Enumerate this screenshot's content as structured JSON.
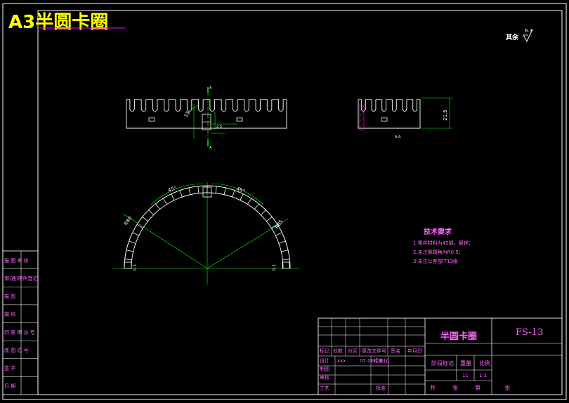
{
  "sheet_title": "A3半圆卡圈",
  "roughness": {
    "label": "其余",
    "value": "6.3"
  },
  "tech": {
    "heading": "技术要求",
    "items": [
      "1.零件材料为45钢，镀锌；",
      "2.未注倒圆角为R0.5；",
      "3.未注公差按IT13级"
    ]
  },
  "title_block": {
    "part_name": "半圆卡圈",
    "drawing_no": "FS-13",
    "header_row": [
      "标记",
      "处数",
      "分区",
      "更改文件号",
      "签名",
      "年月日"
    ],
    "design_row": [
      "设计",
      "xxx",
      "07.06.18",
      "标准化"
    ],
    "left_labels": [
      "制图",
      "审核",
      "工艺"
    ],
    "approve": "批准",
    "stage_label": "阶段标记",
    "weight_label": "重量",
    "scale_label": "比例",
    "weight_value": "11",
    "scale_value": "1:1",
    "sheets": [
      "共",
      "张",
      "第",
      "张"
    ]
  },
  "margin_labels": [
    "描 图 审 核",
    "借(通)用件登记",
    "描 图",
    "描 校",
    "旧 底 图 总 号",
    "底 图 总 号",
    "签 字",
    "日 期"
  ],
  "dims": {
    "angle_left": "45°",
    "angle_right": "45°",
    "r_left": "R80",
    "r_right": "R85",
    "end_left": "0.1",
    "end_right": "0.1",
    "height": "21.5",
    "section_a_top": "A",
    "section_a_bottom": "A",
    "section_label": "A-A",
    "slot_width": "15",
    "tooth": "2.5"
  },
  "colors": {
    "frame": "#ffffff",
    "title_yellow": "#ffff00",
    "magenta": "#ff00ff",
    "green": "#00ff00",
    "label_magenta": "#ff66ff"
  }
}
